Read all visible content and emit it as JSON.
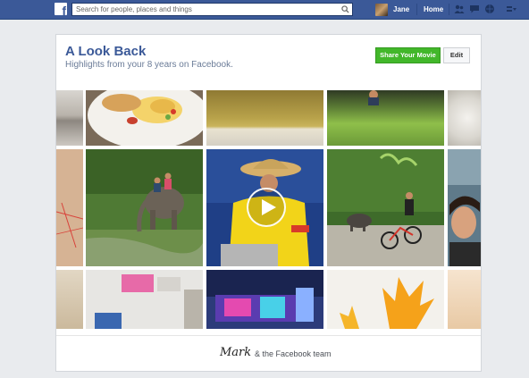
{
  "topbar": {
    "logo_icon": "facebook-f-icon",
    "search_placeholder": "Search for people, places and things",
    "user_name": "Jane",
    "home_label": "Home",
    "icons": [
      "friend-requests-icon",
      "messages-icon",
      "notifications-icon",
      "settings-icon"
    ],
    "brand_color": "#3b5998"
  },
  "lookback": {
    "title": "A Look Back",
    "subtitle": "Highlights from your 8 years on Facebook.",
    "share_label": "Share Your Movie",
    "edit_label": "Edit",
    "share_color": "#42b72a"
  },
  "photos": [
    {
      "name": "photo-plate-edge",
      "desc": "plate"
    },
    {
      "name": "photo-breakfast-plate",
      "desc": "food"
    },
    {
      "name": "photo-grass-field",
      "desc": "grass"
    },
    {
      "name": "photo-garden-person",
      "desc": "garden"
    },
    {
      "name": "photo-flower-edge",
      "desc": "flower"
    },
    {
      "name": "photo-red-string",
      "desc": "wall"
    },
    {
      "name": "photo-elephant-ride",
      "desc": "elephant"
    },
    {
      "name": "photo-cooking-video",
      "desc": "video"
    },
    {
      "name": "photo-cyclist-buffalo",
      "desc": "bike"
    },
    {
      "name": "photo-woman-portrait",
      "desc": "portrait"
    },
    {
      "name": "photo-wood-edge",
      "desc": "wood"
    },
    {
      "name": "photo-desk-items",
      "desc": "desk"
    },
    {
      "name": "photo-led-display",
      "desc": "led"
    },
    {
      "name": "photo-orange-flowers",
      "desc": "flowers"
    },
    {
      "name": "photo-peach-edge",
      "desc": "peach"
    }
  ],
  "footer": {
    "signature": "Mark",
    "team_text": "& the Facebook team"
  }
}
